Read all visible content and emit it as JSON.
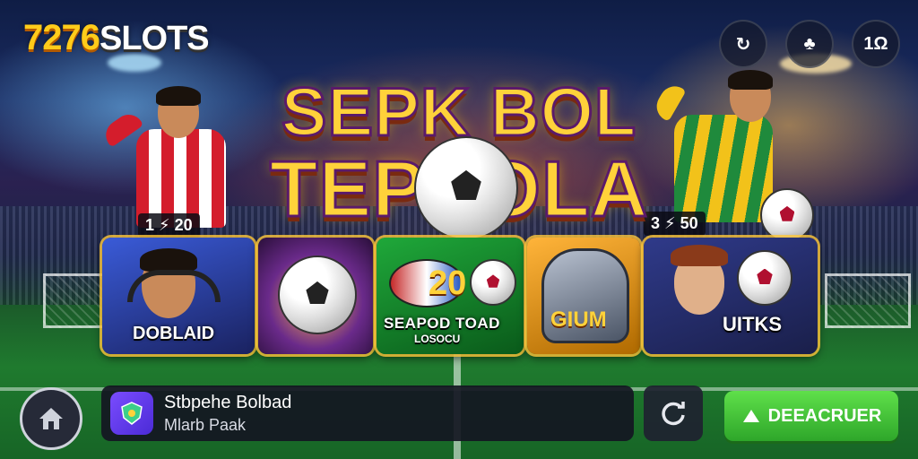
{
  "brand": {
    "logo_number": "7276",
    "logo_text": "SLOTS"
  },
  "top_buttons": [
    {
      "icon": "refresh-circle-icon",
      "glyph": "↻"
    },
    {
      "icon": "clover-icon",
      "glyph": "♣"
    },
    {
      "icon": "settings-icon",
      "glyph": "1Ω"
    }
  ],
  "hero": {
    "title_line1": "SEPK BOL",
    "title_line2_left": "TEP",
    "title_line2_right": "SOLA",
    "player_left_score": "1 ⚡ 20",
    "player_right_score": "3 ⚡ 50"
  },
  "tiles": [
    {
      "label": "DOBLAID",
      "sub": ""
    },
    {
      "label": "",
      "sub": ""
    },
    {
      "label": "20",
      "sub": "SEAPOD TOAD",
      "sub2": "LOSOCU"
    },
    {
      "label": "GIUM",
      "sub": ""
    },
    {
      "label": "UITKS",
      "sub": ""
    }
  ],
  "bottom": {
    "game_name": "Stbpehe Bolbad",
    "game_sub": "Mlarb Paak",
    "cta_label": "DEEACRUER"
  },
  "colors": {
    "accent_gold": "#ffd23a",
    "cta_green": "#3fbf36",
    "panel": "#141622"
  }
}
